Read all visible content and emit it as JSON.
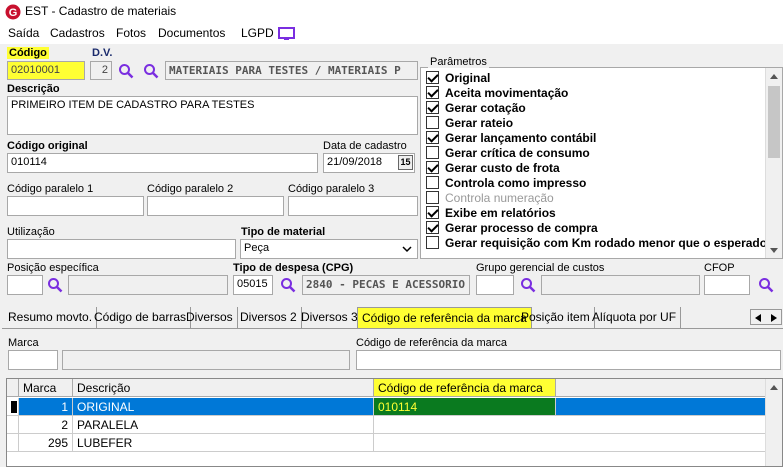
{
  "window": {
    "title": "EST - Cadastro de materiais"
  },
  "menu": {
    "items": [
      "Saída",
      "Cadastros",
      "Fotos",
      "Documentos",
      "LGPD"
    ]
  },
  "form": {
    "codigo": {
      "label": "Código",
      "value": "02010001"
    },
    "dv": {
      "label": "D.V.",
      "value": "2"
    },
    "grupo_desc": "MATERIAIS PARA TESTES / MATERIAIS P",
    "descricao": {
      "label": "Descrição",
      "value": "PRIMEIRO ITEM DE CADASTRO PARA TESTES"
    },
    "codigo_original": {
      "label": "Código original",
      "value": "010114"
    },
    "data_cadastro": {
      "label": "Data de cadastro",
      "value": "21/09/2018",
      "cal_icon": "15"
    },
    "codigo_paralelo_1": {
      "label": "Código paralelo 1",
      "value": ""
    },
    "codigo_paralelo_2": {
      "label": "Código paralelo 2",
      "value": ""
    },
    "codigo_paralelo_3": {
      "label": "Código paralelo 3",
      "value": ""
    },
    "utilizacao": {
      "label": "Utilização",
      "value": ""
    },
    "tipo_material": {
      "label": "Tipo de material",
      "value": "Peça"
    },
    "posicao_especifica": {
      "label": "Posição específica",
      "value": ""
    },
    "tipo_despesa": {
      "label": "Tipo de despesa (CPG)",
      "code": "05015",
      "desc": "2840 - PECAS E ACESSORIO"
    },
    "grupo_gerencial": {
      "label": "Grupo gerencial de custos",
      "value": ""
    },
    "cfop": {
      "label": "CFOP",
      "value": ""
    }
  },
  "parametros": {
    "title": "Parâmetros",
    "items": [
      {
        "label": "Original",
        "checked": true,
        "disabled": false
      },
      {
        "label": "Aceita movimentação",
        "checked": true,
        "disabled": false
      },
      {
        "label": "Gerar cotação",
        "checked": true,
        "disabled": false
      },
      {
        "label": "Gerar rateio",
        "checked": false,
        "disabled": false
      },
      {
        "label": "Gerar lançamento contábil",
        "checked": true,
        "disabled": false
      },
      {
        "label": "Gerar crítica de consumo",
        "checked": false,
        "disabled": false
      },
      {
        "label": "Gerar custo de frota",
        "checked": true,
        "disabled": false
      },
      {
        "label": "Controla como impresso",
        "checked": false,
        "disabled": false
      },
      {
        "label": "Controla numeração",
        "checked": false,
        "disabled": true
      },
      {
        "label": "Exibe em relatórios",
        "checked": true,
        "disabled": false
      },
      {
        "label": "Gerar processo de compra",
        "checked": true,
        "disabled": false
      },
      {
        "label": "Gerar requisição com Km rodado menor que o esperado",
        "checked": false,
        "disabled": false
      }
    ]
  },
  "tabs": [
    "Resumo movto.",
    "Código de barras",
    "Diversos",
    "Diversos 2",
    "Diversos 3",
    "Código de referência da marca",
    "Posição item",
    "Alíquota por UF"
  ],
  "active_tab": "Código de referência da marca",
  "marca_panel": {
    "marca_label": "Marca",
    "codigo_ref_label": "Código de referência da marca"
  },
  "grid": {
    "columns": [
      "Marca",
      "Descrição",
      "Código de referência da marca"
    ],
    "rows": [
      {
        "marca": "1",
        "descricao": "ORIGINAL",
        "codigo_ref": "010114",
        "selected": true
      },
      {
        "marca": "2",
        "descricao": "PARALELA",
        "codigo_ref": "",
        "selected": false
      },
      {
        "marca": "295",
        "descricao": "LUBEFER",
        "codigo_ref": "",
        "selected": false
      }
    ]
  },
  "colors": {
    "highlight": "#ffff33",
    "selection": "#0078d7",
    "brand": "#c8102e"
  }
}
